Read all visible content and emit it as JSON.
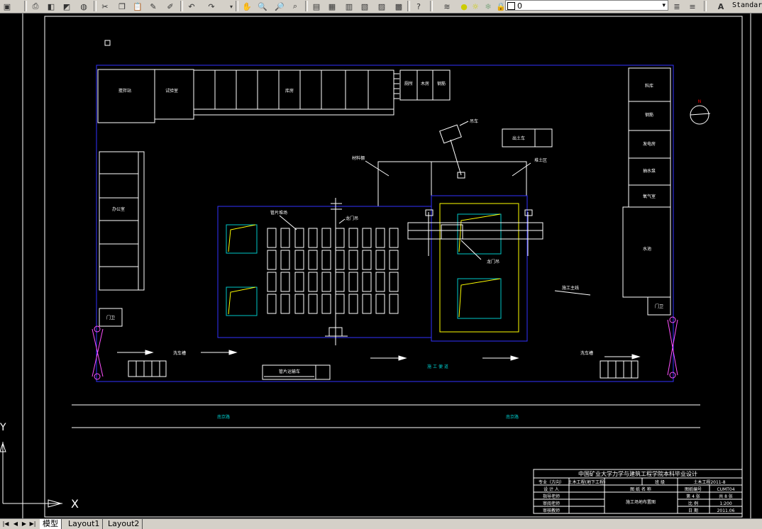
{
  "toolbar": {
    "layer_value": "0",
    "text_style": "Standar",
    "icons": [
      "save-icon",
      "print-icon",
      "preview-icon",
      "publish-icon",
      "plot-icon",
      "cut-icon",
      "copy-icon",
      "paste-icon",
      "brush-icon",
      "pencil-icon",
      "undo-icon",
      "redo-icon",
      "pan-icon",
      "zoom-realtime-icon",
      "zoom-window-icon",
      "zoom-previous-icon",
      "properties-icon",
      "design-center-icon",
      "tool-palette-icon",
      "sheetset-icon",
      "markup-icon",
      "calculator-icon",
      "help-icon",
      "layer-manager-icon",
      "bulb-icon",
      "sun-icon",
      "freeze-icon",
      "lock-icon",
      "color-box-icon",
      "layer-previous-icon",
      "text-style-icon"
    ]
  },
  "drawing": {
    "labels": {
      "lab_mix": "搅拌站",
      "lab_test": "试验室",
      "lab_store": "库房",
      "lab_toilet": "厕所",
      "lab_tool1": "木房",
      "lab_tool2": "钢筋",
      "lab_material": "料库",
      "lab_steel": "钢筋",
      "lab_power": "发电房",
      "lab_pump": "抽水泵",
      "lab_gas": "氧气室",
      "lab_water": "水池",
      "lab_office": "办公室",
      "lab_gate1": "门卫",
      "lab_gate2": "门卫",
      "lab_crane": "吊车",
      "lab_soil": "出土车",
      "lab_storage": "堆土区",
      "lab_shed": "材料棚",
      "lab_pile": "管片堆场",
      "lab_gantry1": "龙门吊",
      "lab_gantry2": "龙门吊",
      "lab_trunk": "施工主线",
      "lab_wash1": "洗车槽",
      "lab_wash2": "洗车槽",
      "lab_road": "施 工 便 道",
      "lab_truck": "管片运输车",
      "lab_street1": "南京路",
      "lab_street2": "南京路"
    },
    "command": {
      "y_axis": "Y",
      "x_axis": "X"
    }
  },
  "title_block": {
    "school": "中国矿业大学力学与建筑工程学院本科毕业设计",
    "r1": [
      "专业（方向）",
      "土木工程(地下工程)",
      "班 级",
      "土木工程2011-8"
    ],
    "r2": [
      "设 计 人",
      "",
      "图 纸 名 称",
      "图纸编号",
      "CUMT04"
    ],
    "r3": [
      "指导老师",
      "",
      "施工场地布置图",
      "第 4 张",
      "共 8 张"
    ],
    "r4": [
      "审阅老师",
      "",
      "",
      "比 例",
      "1:200"
    ],
    "r5": [
      "审核教师",
      "",
      "",
      "日 期",
      "2011.06"
    ]
  },
  "tabs": {
    "items": [
      "模型",
      "Layout1",
      "Layout2"
    ]
  }
}
